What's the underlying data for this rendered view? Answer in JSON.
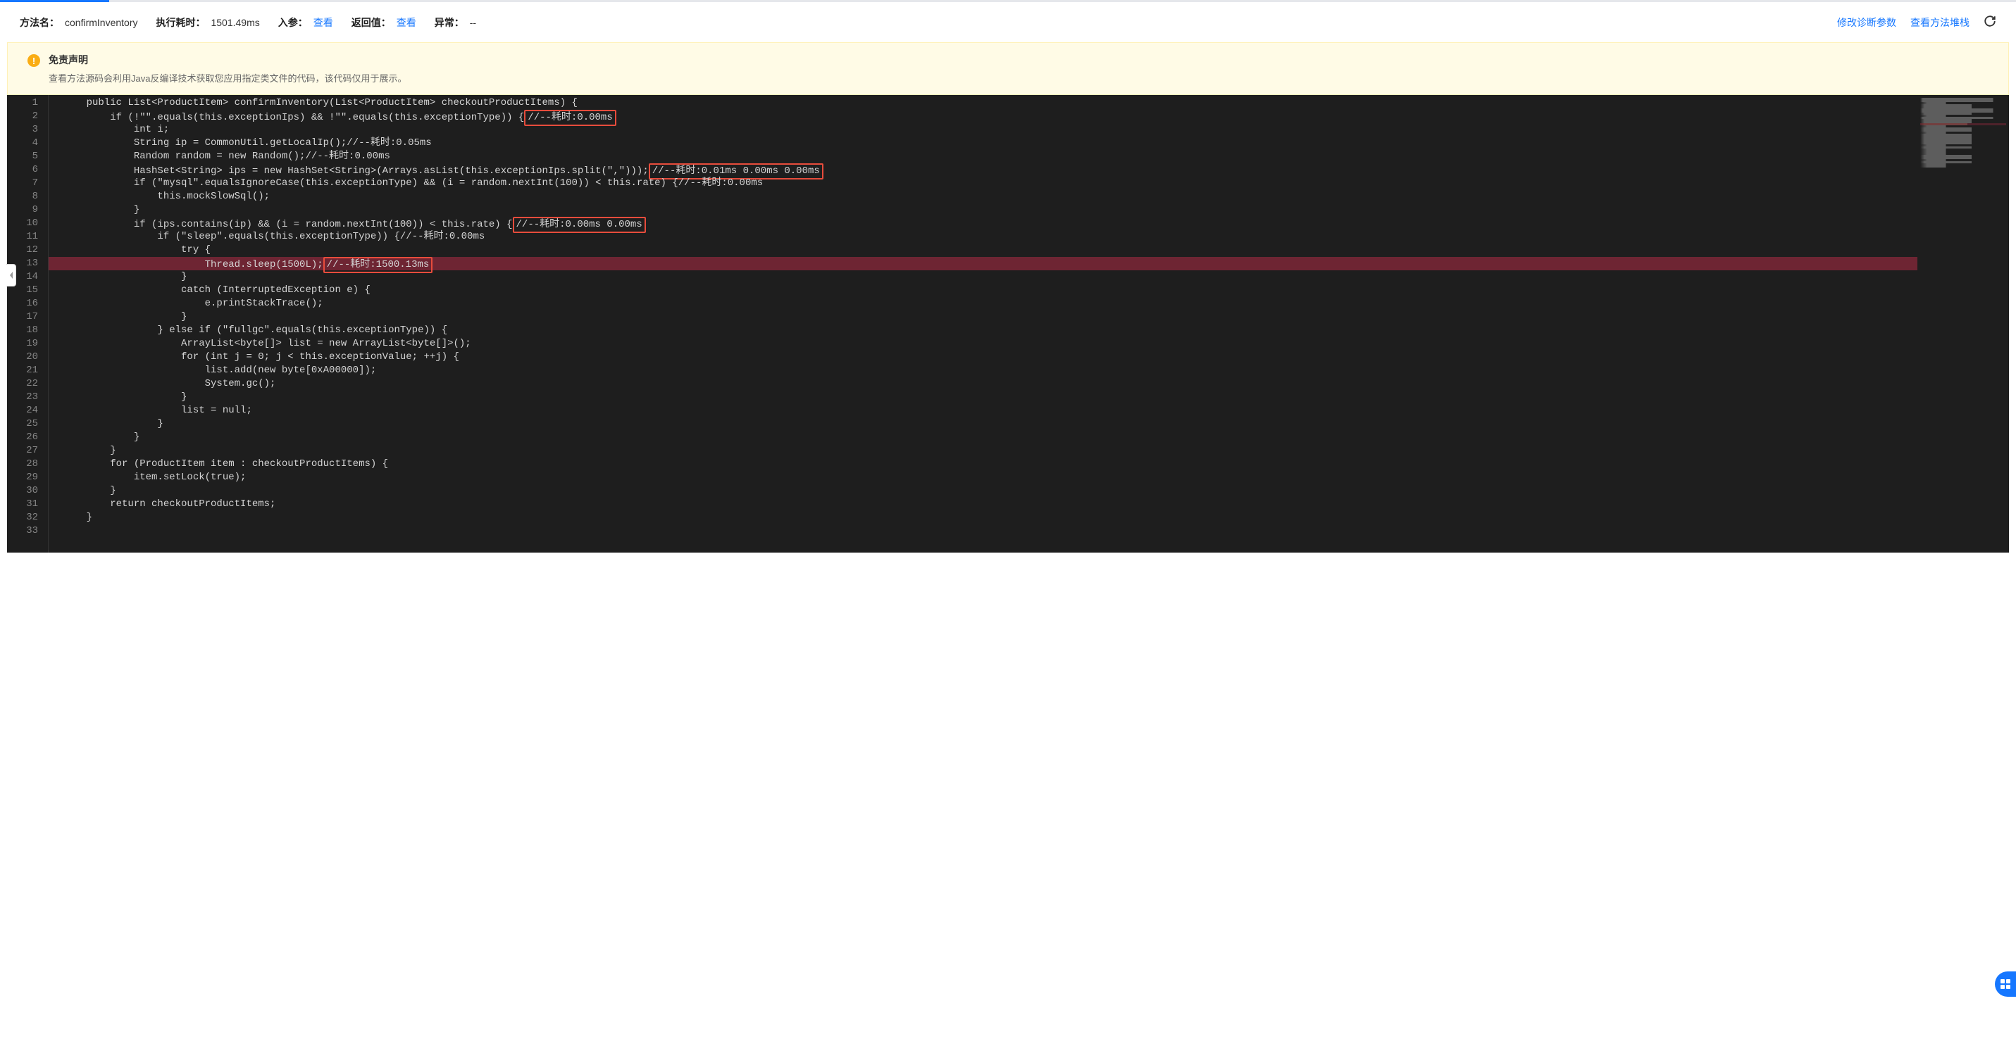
{
  "header": {
    "method_name_label": "方法名：",
    "method_name_value": "confirmInventory",
    "exec_time_label": "执行耗时：",
    "exec_time_value": "1501.49ms",
    "input_label": "入参：",
    "view_link_text": "查看",
    "return_label": "返回值：",
    "exception_label": "异常：",
    "exception_value": "--",
    "modify_params_link": "修改诊断参数",
    "view_stack_link": "查看方法堆栈"
  },
  "notice": {
    "title": "免责声明",
    "desc": "查看方法源码会利用Java反编译技术获取您应用指定类文件的代码，该代码仅用于展示。"
  },
  "code": {
    "lines": [
      {
        "num": 1,
        "hl": false,
        "text": "    public List<ProductItem> confirmInventory(List<ProductItem> checkoutProductItems) {"
      },
      {
        "num": 2,
        "hl": false,
        "text": "        if (!\"\".equals(this.exceptionIps) && !\"\".equals(this.exceptionType)) {",
        "box1": "//--耗时:0.00ms"
      },
      {
        "num": 3,
        "hl": false,
        "text": "            int i;"
      },
      {
        "num": 4,
        "hl": false,
        "text": "            String ip = CommonUtil.getLocalIp();//--耗时:0.05ms"
      },
      {
        "num": 5,
        "hl": false,
        "text": "            Random random = new Random();//--耗时:0.00ms"
      },
      {
        "num": 6,
        "hl": false,
        "text": "            HashSet<String> ips = new HashSet<String>(Arrays.asList(this.exceptionIps.split(\",\")));",
        "box1": "//--耗时:0.01ms 0.00ms 0.00ms"
      },
      {
        "num": 7,
        "hl": false,
        "text": "            if (\"mysql\".equalsIgnoreCase(this.exceptionType) && (i = random.nextInt(100)) < this.rate) {//--耗时:0.00ms"
      },
      {
        "num": 8,
        "hl": false,
        "text": "                this.mockSlowSql();"
      },
      {
        "num": 9,
        "hl": false,
        "text": "            }"
      },
      {
        "num": 10,
        "hl": false,
        "text": "            if (ips.contains(ip) && (i = random.nextInt(100)) < this.rate) {",
        "box1": "//--耗时:0.00ms 0.00ms"
      },
      {
        "num": 11,
        "hl": false,
        "text": "                if (\"sleep\".equals(this.exceptionType)) {//--耗时:0.00ms"
      },
      {
        "num": 12,
        "hl": false,
        "text": "                    try {"
      },
      {
        "num": 13,
        "hl": true,
        "text": "                        Thread.sleep(1500L);",
        "box1": "//--耗时:1500.13ms"
      },
      {
        "num": 14,
        "hl": false,
        "text": "                    }"
      },
      {
        "num": 15,
        "hl": false,
        "text": "                    catch (InterruptedException e) {"
      },
      {
        "num": 16,
        "hl": false,
        "text": "                        e.printStackTrace();"
      },
      {
        "num": 17,
        "hl": false,
        "text": "                    }"
      },
      {
        "num": 18,
        "hl": false,
        "text": "                } else if (\"fullgc\".equals(this.exceptionType)) {"
      },
      {
        "num": 19,
        "hl": false,
        "text": "                    ArrayList<byte[]> list = new ArrayList<byte[]>();"
      },
      {
        "num": 20,
        "hl": false,
        "text": "                    for (int j = 0; j < this.exceptionValue; ++j) {"
      },
      {
        "num": 21,
        "hl": false,
        "text": "                        list.add(new byte[0xA00000]);"
      },
      {
        "num": 22,
        "hl": false,
        "text": "                        System.gc();"
      },
      {
        "num": 23,
        "hl": false,
        "text": "                    }"
      },
      {
        "num": 24,
        "hl": false,
        "text": "                    list = null;"
      },
      {
        "num": 25,
        "hl": false,
        "text": "                }"
      },
      {
        "num": 26,
        "hl": false,
        "text": "            }"
      },
      {
        "num": 27,
        "hl": false,
        "text": "        }"
      },
      {
        "num": 28,
        "hl": false,
        "text": "        for (ProductItem item : checkoutProductItems) {"
      },
      {
        "num": 29,
        "hl": false,
        "text": "            item.setLock(true);"
      },
      {
        "num": 30,
        "hl": false,
        "text": "        }"
      },
      {
        "num": 31,
        "hl": false,
        "text": "        return checkoutProductItems;"
      },
      {
        "num": 32,
        "hl": false,
        "text": "    }"
      },
      {
        "num": 33,
        "hl": false,
        "text": ""
      }
    ]
  }
}
